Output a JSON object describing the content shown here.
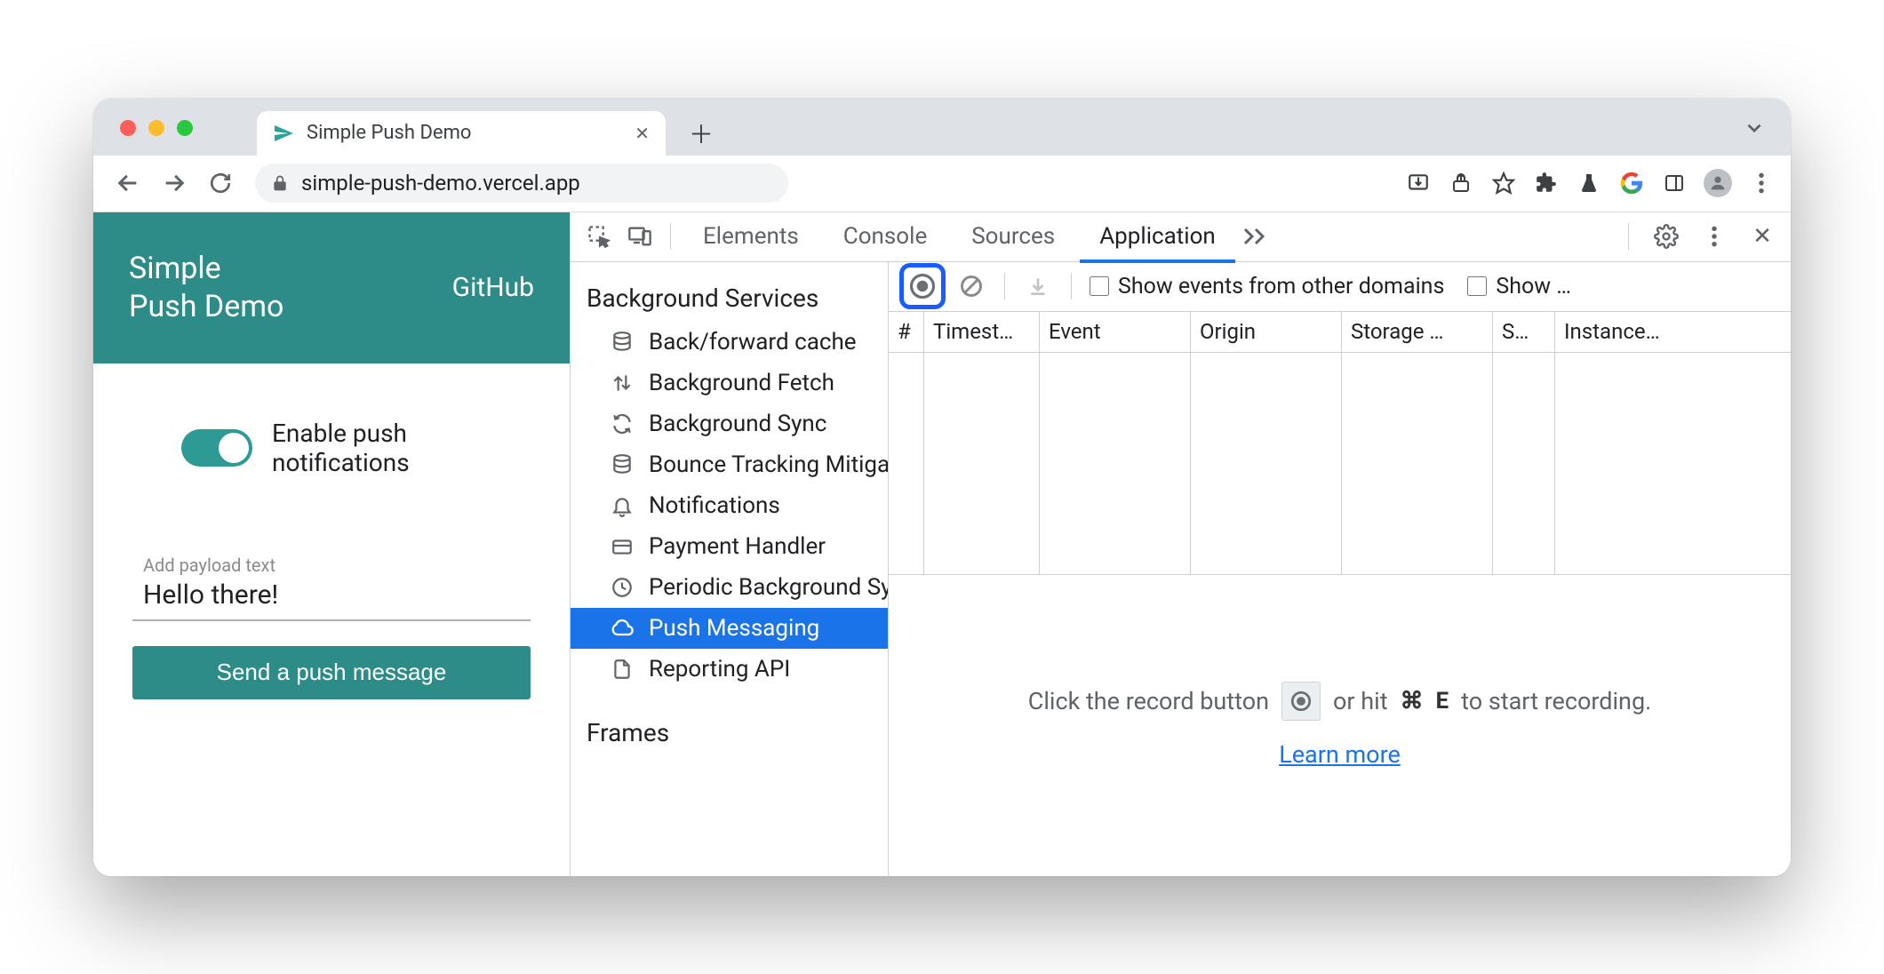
{
  "browser": {
    "tab_title": "Simple Push Demo",
    "url": "simple-push-demo.vercel.app"
  },
  "app": {
    "title_line1": "Simple",
    "title_line2": "Push Demo",
    "github": "GitHub",
    "toggle_label_line1": "Enable push",
    "toggle_label_line2": "notifications",
    "payload_label": "Add payload text",
    "payload_value": "Hello there!",
    "send_label": "Send a push message"
  },
  "devtools": {
    "tabs": {
      "elements": "Elements",
      "console": "Console",
      "sources": "Sources",
      "application": "Application"
    },
    "side_section": "Background Services",
    "side_items": [
      "Back/forward cache",
      "Background Fetch",
      "Background Sync",
      "Bounce Tracking Mitigations",
      "Notifications",
      "Payment Handler",
      "Periodic Background Sync",
      "Push Messaging",
      "Reporting API"
    ],
    "side_section2": "Frames",
    "toolbar": {
      "show_other": "Show events from other domains",
      "show_trunc": "Show …"
    },
    "columns": [
      "#",
      "Timest…",
      "Event",
      "Origin",
      "Storage …",
      "S…",
      "Instance…"
    ],
    "empty": {
      "prefix": "Click the record button",
      "mid": "or hit",
      "key1": "⌘",
      "key2": "E",
      "suffix": "to start recording.",
      "learn": "Learn more"
    }
  }
}
